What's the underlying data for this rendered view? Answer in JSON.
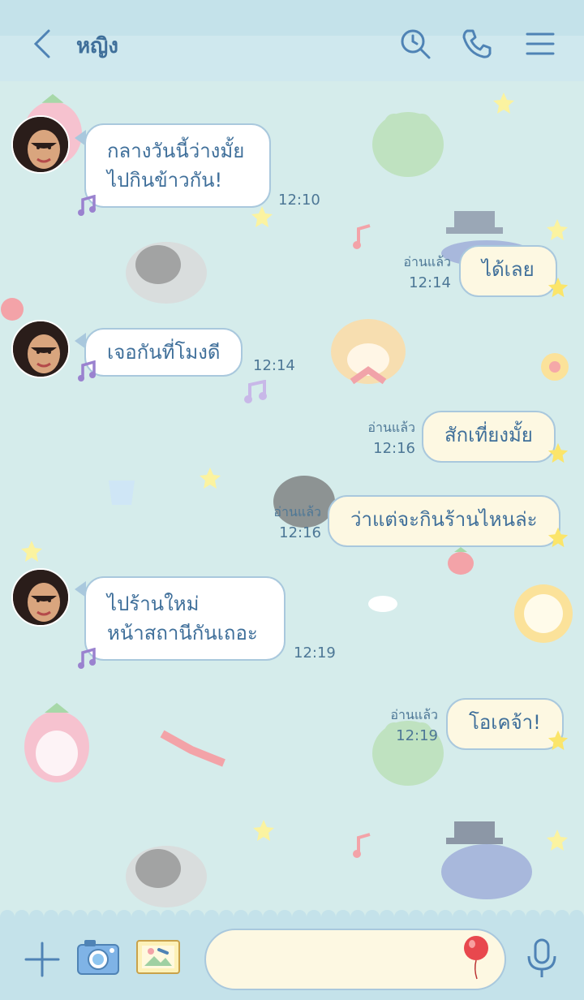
{
  "header": {
    "title": "หญิง",
    "icons": [
      "back-icon",
      "search-icon",
      "phone-icon",
      "menu-icon"
    ]
  },
  "messages": [
    {
      "side": "in",
      "lines": [
        "กลางวันนี้ว่างมั้ย",
        "ไปกินข้าวกัน!"
      ],
      "time": "12:10"
    },
    {
      "side": "out",
      "text": "ได้เลย",
      "read": "อ่านแล้ว",
      "time": "12:14"
    },
    {
      "side": "in",
      "lines": [
        "เจอกันที่โมงดี"
      ],
      "time": "12:14"
    },
    {
      "side": "out",
      "text": "สักเที่ยงมั้ย",
      "read": "อ่านแล้ว",
      "time": "12:16"
    },
    {
      "side": "out",
      "text": "ว่าแต่จะกินร้านไหนล่ะ",
      "read": "อ่านแล้ว",
      "time": "12:16"
    },
    {
      "side": "in",
      "lines": [
        "ไปร้านใหม่",
        "หน้าสถานีกันเถอะ"
      ],
      "time": "12:19"
    },
    {
      "side": "out",
      "text": "โอเคจ้า!",
      "read": "อ่านแล้ว",
      "time": "12:19"
    }
  ],
  "input": {
    "placeholder": ""
  },
  "bottom_icons": [
    "plus-icon",
    "camera-icon",
    "image-icon",
    "balloon-icon",
    "microphone-icon"
  ],
  "colors": {
    "accent": "#3f6f9a",
    "background": "#d5eceb",
    "bar": "#c4e2ea",
    "incoming_bubble": "#ffffff",
    "outgoing_bubble": "#fdf8e2",
    "bubble_border": "#a9c8dd"
  }
}
